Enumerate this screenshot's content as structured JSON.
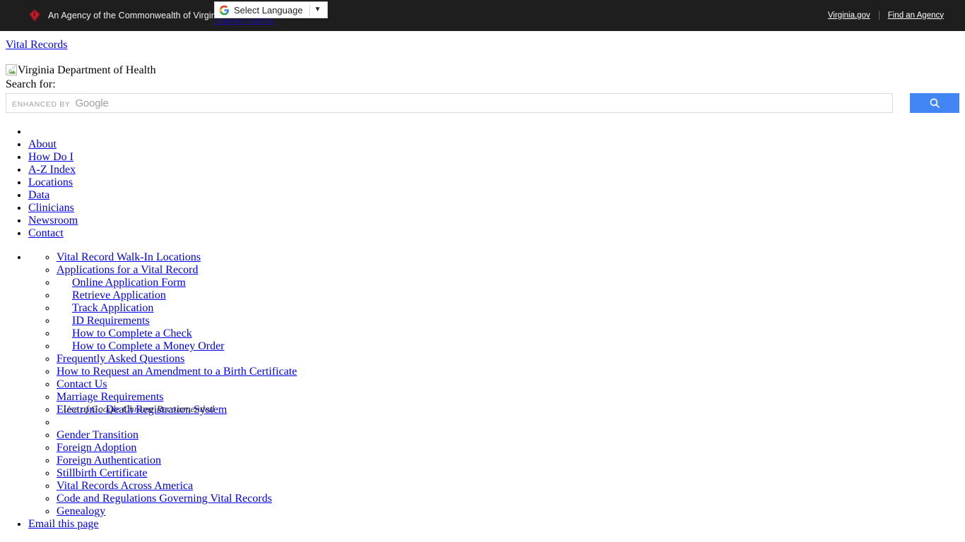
{
  "commonwealth_bar": {
    "logo_icon": "virginia-diamond-logo",
    "agency_text": "An Agency of the Commonwealth of Virginia",
    "links": [
      {
        "label": "Virginia.gov"
      },
      {
        "label": "Find an Agency"
      }
    ],
    "background_color": "#1e1e1e"
  },
  "translate_widget": {
    "icon": "google-g-icon",
    "label": "Select Language",
    "caret_icon": "chevron-down-icon"
  },
  "skip_link": {
    "label": "Skip to content"
  },
  "site": {
    "title_link": "Vital Records",
    "logo_alt": "Virginia Department of Health",
    "broken_image_icon": "broken-image-icon"
  },
  "search": {
    "label": "Search for:",
    "watermark_enhanced": "ENHANCED BY",
    "watermark_brand": "Google",
    "placeholder": "",
    "value": "",
    "button_icon": "search-icon",
    "button_color": "#4285f4"
  },
  "primary_nav": {
    "items": [
      {
        "label": ""
      },
      {
        "label": "About"
      },
      {
        "label": "How Do I"
      },
      {
        "label": "A-Z Index"
      },
      {
        "label": "Locations"
      },
      {
        "label": "Data"
      },
      {
        "label": "Clinicians"
      },
      {
        "label": "Newsroom"
      },
      {
        "label": "Contact"
      }
    ]
  },
  "section_nav": {
    "items": [
      {
        "label": "Vital Record Walk-In Locations",
        "indent": 0
      },
      {
        "label": "Applications for a Vital Record",
        "indent": 0
      },
      {
        "label": "Online Application Form",
        "indent": 1
      },
      {
        "label": "Retrieve Application",
        "indent": 1
      },
      {
        "label": "Track Application",
        "indent": 1
      },
      {
        "label": "ID Requirements",
        "indent": 1
      },
      {
        "label": "How to Complete a Check",
        "indent": 1
      },
      {
        "label": "How to Complete a Money Order",
        "indent": 1
      },
      {
        "label": "Frequently Asked Questions",
        "indent": 0
      },
      {
        "label": "How to Request an Amendment to a Birth Certificate",
        "indent": 0
      },
      {
        "label": "Contact Us",
        "indent": 0
      },
      {
        "label": "Marriage Requirements",
        "indent": 0
      },
      {
        "label": "Electronic Death Registration System",
        "indent": 0
      },
      {
        "label": "",
        "indent": 0
      },
      {
        "label": "Gender Transition",
        "indent": 0
      },
      {
        "label": "Foreign Adoption",
        "indent": 0
      },
      {
        "label": "Foreign Authentication",
        "indent": 0
      },
      {
        "label": "Stillbirth Certificate",
        "indent": 0
      },
      {
        "label": "Vital Records Across America",
        "indent": 0
      },
      {
        "label": "Code and Regulations Governing Vital Records",
        "indent": 0
      },
      {
        "label": "Genealogy",
        "indent": 0
      }
    ]
  },
  "chrome_note": {
    "text": "Use of Google Chrome Recommended"
  },
  "email_link": {
    "label": "Email this page"
  }
}
